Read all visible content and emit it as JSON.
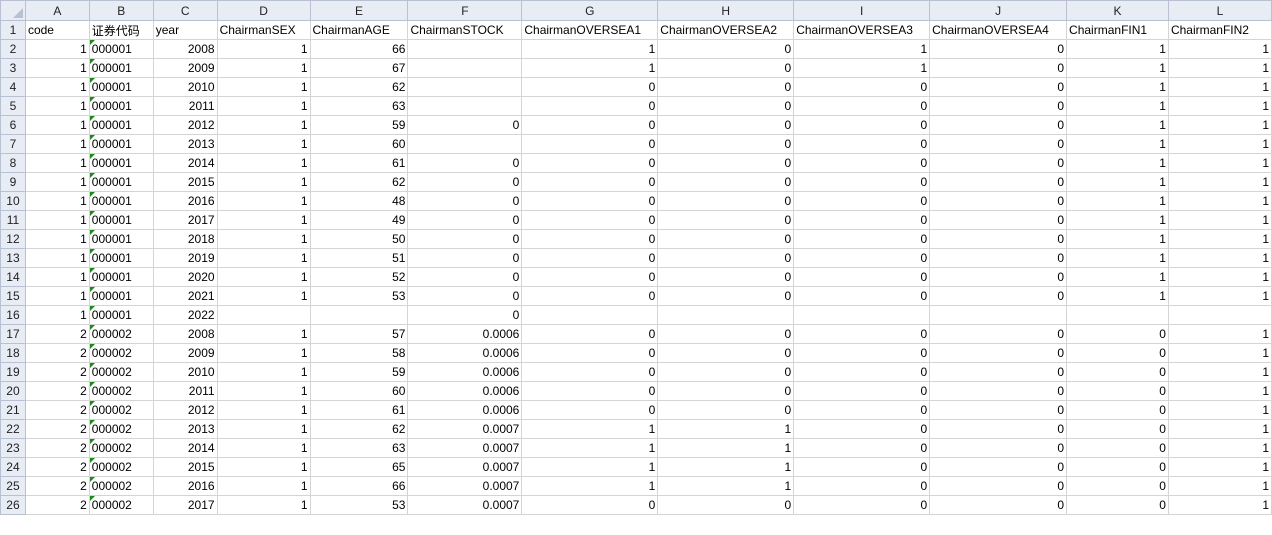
{
  "columns": [
    "A",
    "B",
    "C",
    "D",
    "E",
    "F",
    "G",
    "H",
    "I",
    "J",
    "K",
    "L"
  ],
  "col_widths": [
    64,
    64,
    64,
    93,
    98,
    114,
    136,
    136,
    136,
    137,
    102,
    103
  ],
  "header_row": {
    "row_number": "1",
    "cells": [
      "code",
      "证券代码",
      "year",
      "ChairmanSEX",
      "ChairmanAGE",
      "ChairmanSTOCK",
      "ChairmanOVERSEA1",
      "ChairmanOVERSEA2",
      "ChairmanOVERSEA3",
      "ChairmanOVERSEA4",
      "ChairmanFIN1",
      "ChairmanFIN2"
    ]
  },
  "rows": [
    [
      "2",
      "1",
      "000001",
      "2008",
      "1",
      "66",
      "",
      "1",
      "0",
      "1",
      "0",
      "1",
      "1"
    ],
    [
      "3",
      "1",
      "000001",
      "2009",
      "1",
      "67",
      "",
      "1",
      "0",
      "1",
      "0",
      "1",
      "1"
    ],
    [
      "4",
      "1",
      "000001",
      "2010",
      "1",
      "62",
      "",
      "0",
      "0",
      "0",
      "0",
      "1",
      "1"
    ],
    [
      "5",
      "1",
      "000001",
      "2011",
      "1",
      "63",
      "",
      "0",
      "0",
      "0",
      "0",
      "1",
      "1"
    ],
    [
      "6",
      "1",
      "000001",
      "2012",
      "1",
      "59",
      "0",
      "0",
      "0",
      "0",
      "0",
      "1",
      "1"
    ],
    [
      "7",
      "1",
      "000001",
      "2013",
      "1",
      "60",
      "",
      "0",
      "0",
      "0",
      "0",
      "1",
      "1"
    ],
    [
      "8",
      "1",
      "000001",
      "2014",
      "1",
      "61",
      "0",
      "0",
      "0",
      "0",
      "0",
      "1",
      "1"
    ],
    [
      "9",
      "1",
      "000001",
      "2015",
      "1",
      "62",
      "0",
      "0",
      "0",
      "0",
      "0",
      "1",
      "1"
    ],
    [
      "10",
      "1",
      "000001",
      "2016",
      "1",
      "48",
      "0",
      "0",
      "0",
      "0",
      "0",
      "1",
      "1"
    ],
    [
      "11",
      "1",
      "000001",
      "2017",
      "1",
      "49",
      "0",
      "0",
      "0",
      "0",
      "0",
      "1",
      "1"
    ],
    [
      "12",
      "1",
      "000001",
      "2018",
      "1",
      "50",
      "0",
      "0",
      "0",
      "0",
      "0",
      "1",
      "1"
    ],
    [
      "13",
      "1",
      "000001",
      "2019",
      "1",
      "51",
      "0",
      "0",
      "0",
      "0",
      "0",
      "1",
      "1"
    ],
    [
      "14",
      "1",
      "000001",
      "2020",
      "1",
      "52",
      "0",
      "0",
      "0",
      "0",
      "0",
      "1",
      "1"
    ],
    [
      "15",
      "1",
      "000001",
      "2021",
      "1",
      "53",
      "0",
      "0",
      "0",
      "0",
      "0",
      "1",
      "1"
    ],
    [
      "16",
      "1",
      "000001",
      "2022",
      "",
      "",
      "0",
      "",
      "",
      "",
      "",
      "",
      ""
    ],
    [
      "17",
      "2",
      "000002",
      "2008",
      "1",
      "57",
      "0.0006",
      "0",
      "0",
      "0",
      "0",
      "0",
      "1"
    ],
    [
      "18",
      "2",
      "000002",
      "2009",
      "1",
      "58",
      "0.0006",
      "0",
      "0",
      "0",
      "0",
      "0",
      "1"
    ],
    [
      "19",
      "2",
      "000002",
      "2010",
      "1",
      "59",
      "0.0006",
      "0",
      "0",
      "0",
      "0",
      "0",
      "1"
    ],
    [
      "20",
      "2",
      "000002",
      "2011",
      "1",
      "60",
      "0.0006",
      "0",
      "0",
      "0",
      "0",
      "0",
      "1"
    ],
    [
      "21",
      "2",
      "000002",
      "2012",
      "1",
      "61",
      "0.0006",
      "0",
      "0",
      "0",
      "0",
      "0",
      "1"
    ],
    [
      "22",
      "2",
      "000002",
      "2013",
      "1",
      "62",
      "0.0007",
      "1",
      "1",
      "0",
      "0",
      "0",
      "1"
    ],
    [
      "23",
      "2",
      "000002",
      "2014",
      "1",
      "63",
      "0.0007",
      "1",
      "1",
      "0",
      "0",
      "0",
      "1"
    ],
    [
      "24",
      "2",
      "000002",
      "2015",
      "1",
      "65",
      "0.0007",
      "1",
      "1",
      "0",
      "0",
      "0",
      "1"
    ],
    [
      "25",
      "2",
      "000002",
      "2016",
      "1",
      "66",
      "0.0007",
      "1",
      "1",
      "0",
      "0",
      "0",
      "1"
    ],
    [
      "26",
      "2",
      "000002",
      "2017",
      "1",
      "53",
      "0.0007",
      "0",
      "0",
      "0",
      "0",
      "0",
      "1"
    ]
  ]
}
